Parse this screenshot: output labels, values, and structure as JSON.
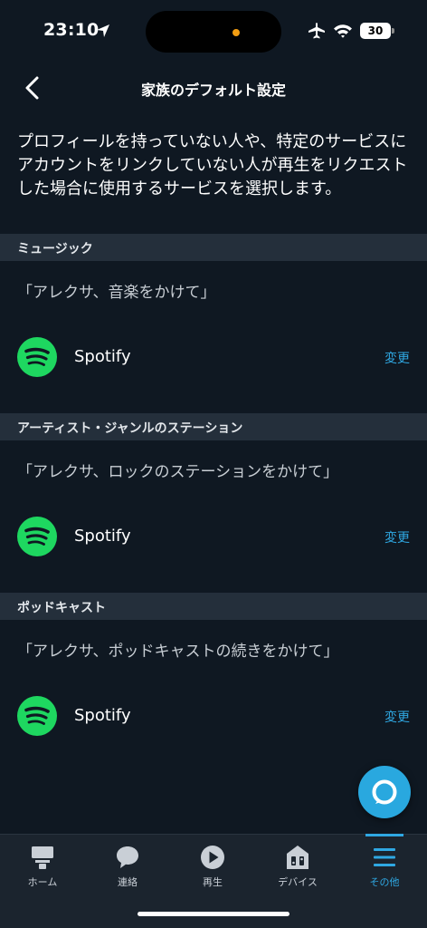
{
  "status_bar": {
    "time": "23:10",
    "battery": "30"
  },
  "header": {
    "title": "家族のデフォルト設定"
  },
  "description": "プロフィールを持っていない人や、特定のサービスにアカウントをリンクしていない人が再生をリクエストした場合に使用するサービスを選択します。",
  "sections": [
    {
      "title": "ミュージック",
      "phrase": "「アレクサ、音楽をかけて」",
      "service": "Spotify",
      "change_label": "変更"
    },
    {
      "title": "アーティスト・ジャンルのステーション",
      "phrase": "「アレクサ、ロックのステーションをかけて」",
      "service": "Spotify",
      "change_label": "変更"
    },
    {
      "title": "ポッドキャスト",
      "phrase": "「アレクサ、ポッドキャストの続きをかけて」",
      "service": "Spotify",
      "change_label": "変更"
    }
  ],
  "bottom_nav": [
    {
      "label": "ホーム",
      "icon": "home-icon"
    },
    {
      "label": "連絡",
      "icon": "chat-bubble-icon"
    },
    {
      "label": "再生",
      "icon": "play-icon"
    },
    {
      "label": "デバイス",
      "icon": "devices-icon"
    },
    {
      "label": "その他",
      "icon": "menu-icon",
      "active": true
    }
  ],
  "colors": {
    "background": "#0f1822",
    "section_header": "#242f3b",
    "accent": "#2fa8e3",
    "spotify": "#1ed760"
  }
}
